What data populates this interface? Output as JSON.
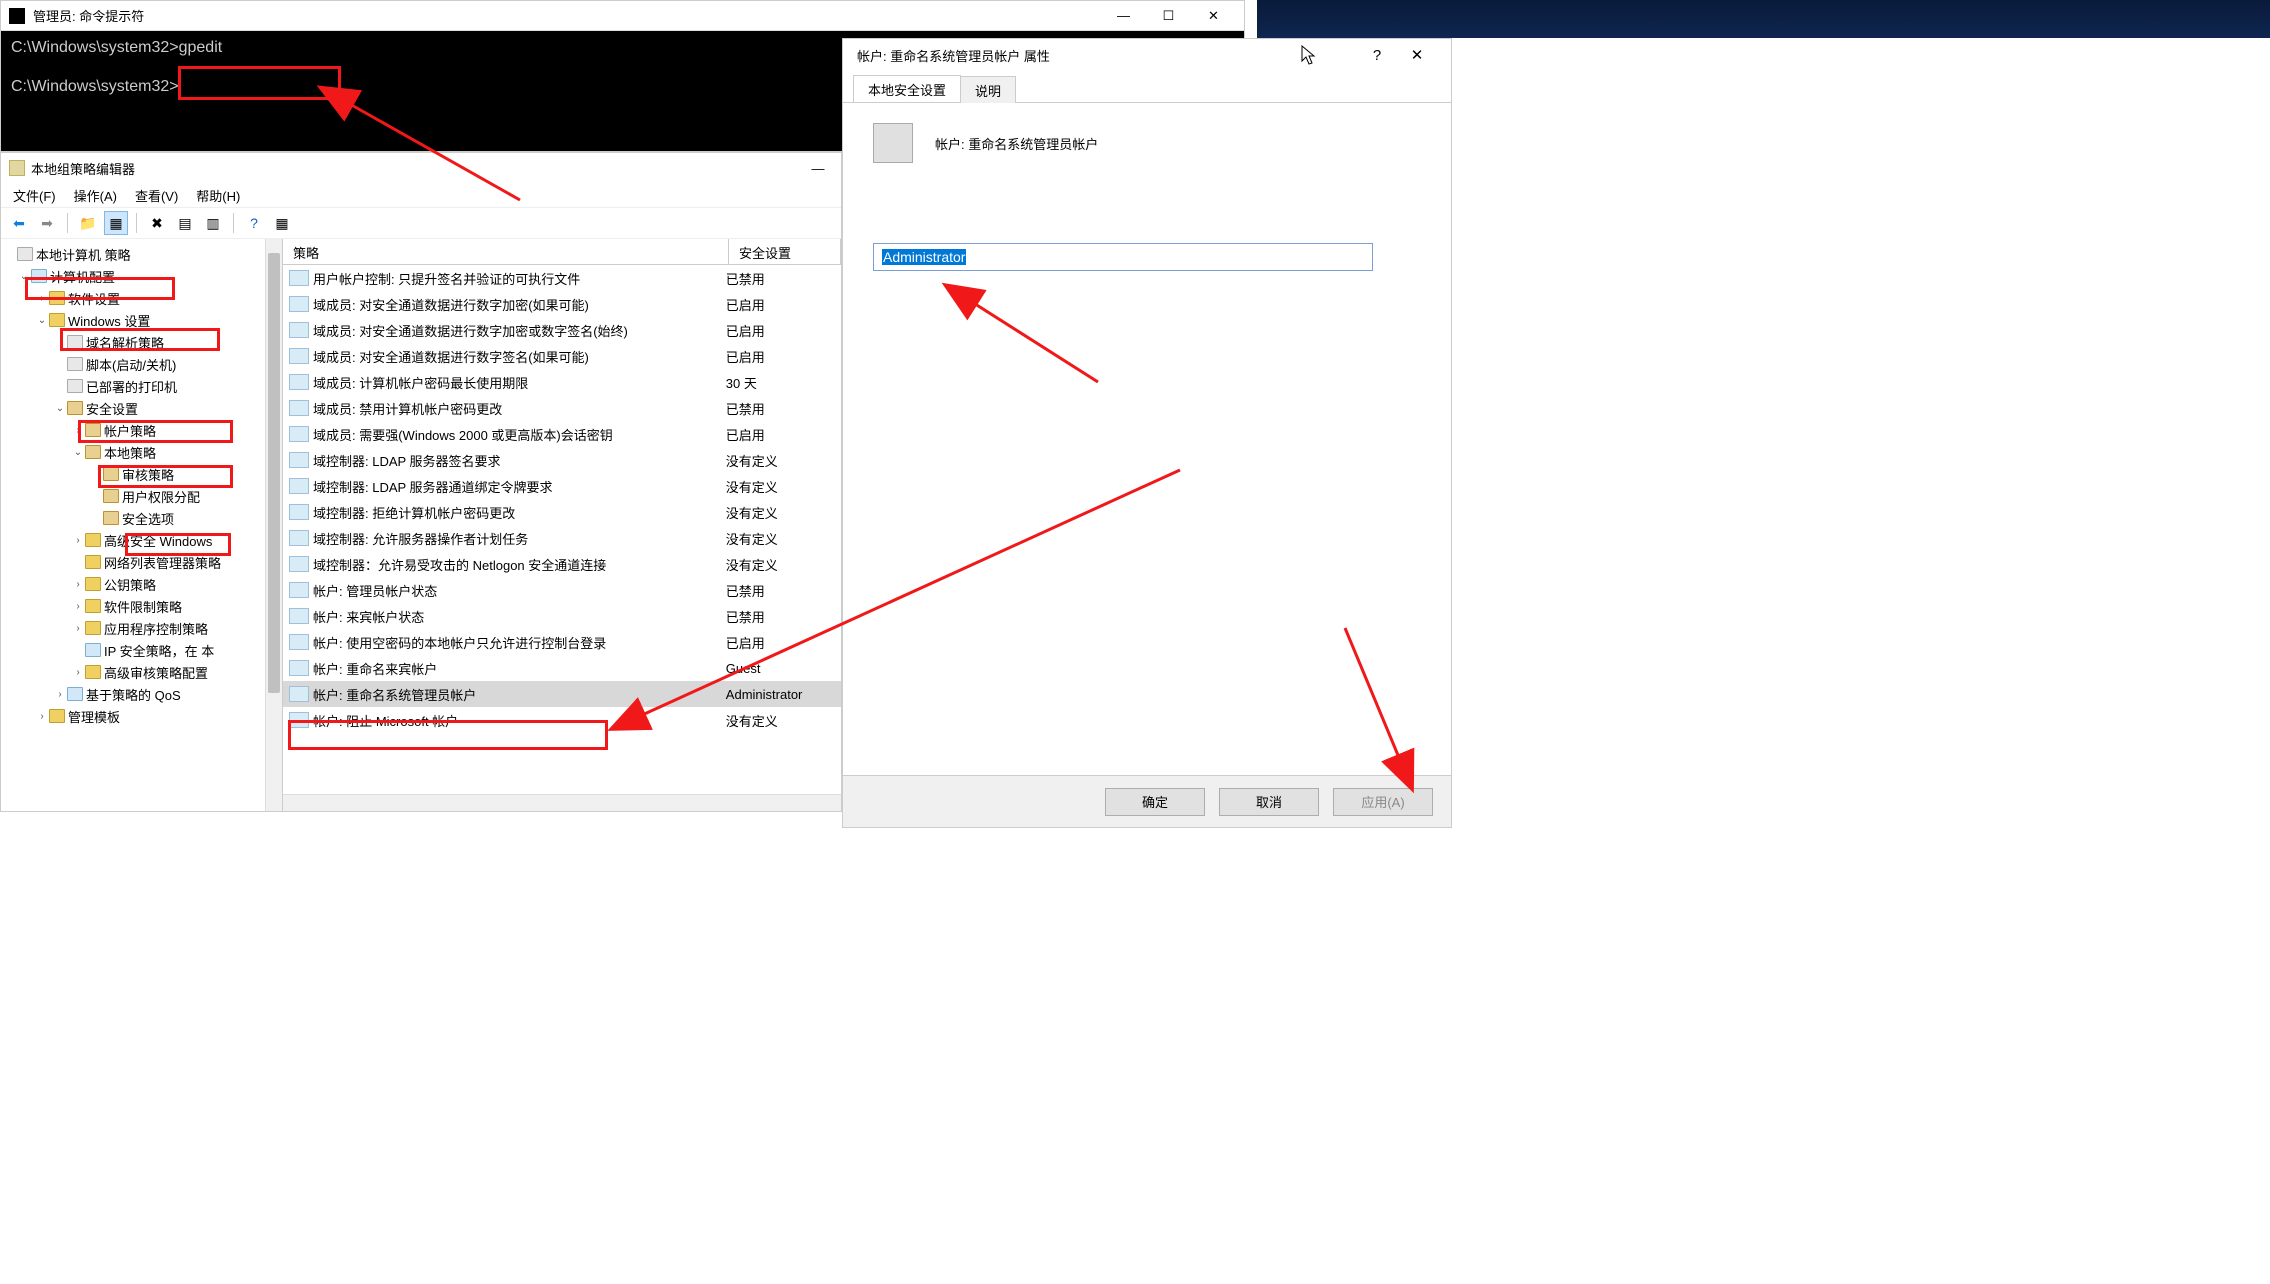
{
  "cmd": {
    "title": "管理员: 命令提示符",
    "line1": "C:\\Windows\\system32>gpedit",
    "line2": "C:\\Windows\\system32>"
  },
  "gpedit": {
    "title": "本地组策略编辑器",
    "menu": {
      "file": "文件(F)",
      "action": "操作(A)",
      "view": "查看(V)",
      "help": "帮助(H)"
    },
    "tree": {
      "root": "本地计算机 策略",
      "computer_config": "计算机配置",
      "software_settings": "软件设置",
      "windows_settings": "Windows 设置",
      "name_resolution": "域名解析策略",
      "scripts": "脚本(启动/关机)",
      "deployed_printers": "已部署的打印机",
      "security_settings": "安全设置",
      "account_policies": "帐户策略",
      "local_policies": "本地策略",
      "audit_policy": "审核策略",
      "user_rights": "用户权限分配",
      "security_options": "安全选项",
      "adv_firewall": "高级安全 Windows",
      "net_list_mgr": "网络列表管理器策略",
      "pubkey_policies": "公钥策略",
      "sw_restrict": "软件限制策略",
      "app_control": "应用程序控制策略",
      "ip_security": "IP 安全策略，在 本",
      "adv_audit": "高级审核策略配置",
      "qos": "基于策略的 QoS",
      "admin_templates": "管理模板"
    },
    "list": {
      "col1": "策略",
      "col2": "安全设置",
      "rows": [
        {
          "name": "用户帐户控制: 只提升签名并验证的可执行文件",
          "val": "已禁用"
        },
        {
          "name": "域成员: 对安全通道数据进行数字加密(如果可能)",
          "val": "已启用"
        },
        {
          "name": "域成员: 对安全通道数据进行数字加密或数字签名(始终)",
          "val": "已启用"
        },
        {
          "name": "域成员: 对安全通道数据进行数字签名(如果可能)",
          "val": "已启用"
        },
        {
          "name": "域成员: 计算机帐户密码最长使用期限",
          "val": "30 天"
        },
        {
          "name": "域成员: 禁用计算机帐户密码更改",
          "val": "已禁用"
        },
        {
          "name": "域成员: 需要强(Windows 2000 或更高版本)会话密钥",
          "val": "已启用"
        },
        {
          "name": "域控制器: LDAP 服务器签名要求",
          "val": "没有定义"
        },
        {
          "name": "域控制器: LDAP 服务器通道绑定令牌要求",
          "val": "没有定义"
        },
        {
          "name": "域控制器: 拒绝计算机帐户密码更改",
          "val": "没有定义"
        },
        {
          "name": "域控制器: 允许服务器操作者计划任务",
          "val": "没有定义"
        },
        {
          "name": "域控制器：允许易受攻击的 Netlogon 安全通道连接",
          "val": "没有定义"
        },
        {
          "name": "帐户: 管理员帐户状态",
          "val": "已禁用"
        },
        {
          "name": "帐户: 来宾帐户状态",
          "val": "已禁用"
        },
        {
          "name": "帐户: 使用空密码的本地帐户只允许进行控制台登录",
          "val": "已启用"
        },
        {
          "name": "帐户: 重命名来宾帐户",
          "val": "Guest"
        },
        {
          "name": "帐户: 重命名系统管理员帐户",
          "val": "Administrator",
          "selected": true
        },
        {
          "name": "帐户: 阻止 Microsoft 帐户",
          "val": "没有定义"
        }
      ]
    }
  },
  "prop": {
    "title": "帐户: 重命名系统管理员帐户 属性",
    "tabs": {
      "local": "本地安全设置",
      "explain": "说明"
    },
    "header": "帐户: 重命名系统管理员帐户",
    "input_value": "Administrator",
    "ok": "确定",
    "cancel": "取消",
    "apply": "应用(A)"
  }
}
